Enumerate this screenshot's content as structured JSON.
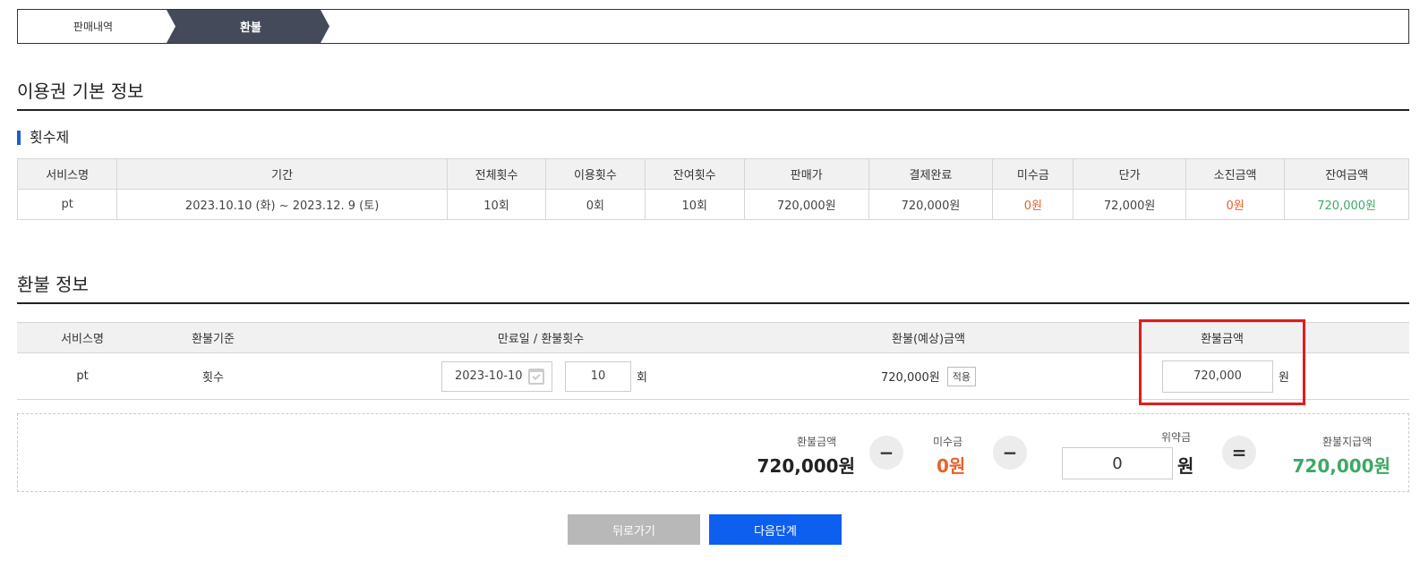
{
  "steps": {
    "step1": "판매내역",
    "step2": "환불"
  },
  "section1": {
    "title": "이용권 기본 정보",
    "subtitle": "횟수제",
    "headers": [
      "서비스명",
      "기간",
      "전체횟수",
      "이용횟수",
      "잔여횟수",
      "판매가",
      "결제완료",
      "미수금",
      "단가",
      "소진금액",
      "잔여금액"
    ],
    "row": [
      "pt",
      "2023.10.10 (화) ~ 2023.12. 9 (토)",
      "10회",
      "0회",
      "10회",
      "720,000원",
      "720,000원",
      "0원",
      "72,000원",
      "0원",
      "720,000원"
    ]
  },
  "section2": {
    "title": "환불 정보",
    "headers": {
      "service": "서비스명",
      "basis": "환불기준",
      "expiry": "만료일 / 환불횟수",
      "expected": "환불(예상)금액",
      "amount": "환불금액"
    },
    "row": {
      "service": "pt",
      "basis": "횟수",
      "date": "2023-10-10",
      "count": "10",
      "count_unit": "회",
      "expected": "720,000원",
      "apply": "적용",
      "amount": "720,000",
      "amount_unit": "원"
    }
  },
  "summary": {
    "refund_label": "환불금액",
    "refund_value": "720,000원",
    "minus1": "−",
    "unpaid_label": "미수금",
    "unpaid_value": "0원",
    "minus2": "−",
    "penalty_label": "위약금",
    "penalty_value": "0",
    "penalty_unit": "원",
    "equals": "=",
    "payout_label": "환불지급액",
    "payout_value": "720,000원"
  },
  "buttons": {
    "back": "뒤로가기",
    "next": "다음단계"
  },
  "colors": {
    "accent": "#0d5ff0",
    "orange": "#e8622a",
    "green": "#3da866",
    "highlight": "#e11c1c"
  }
}
